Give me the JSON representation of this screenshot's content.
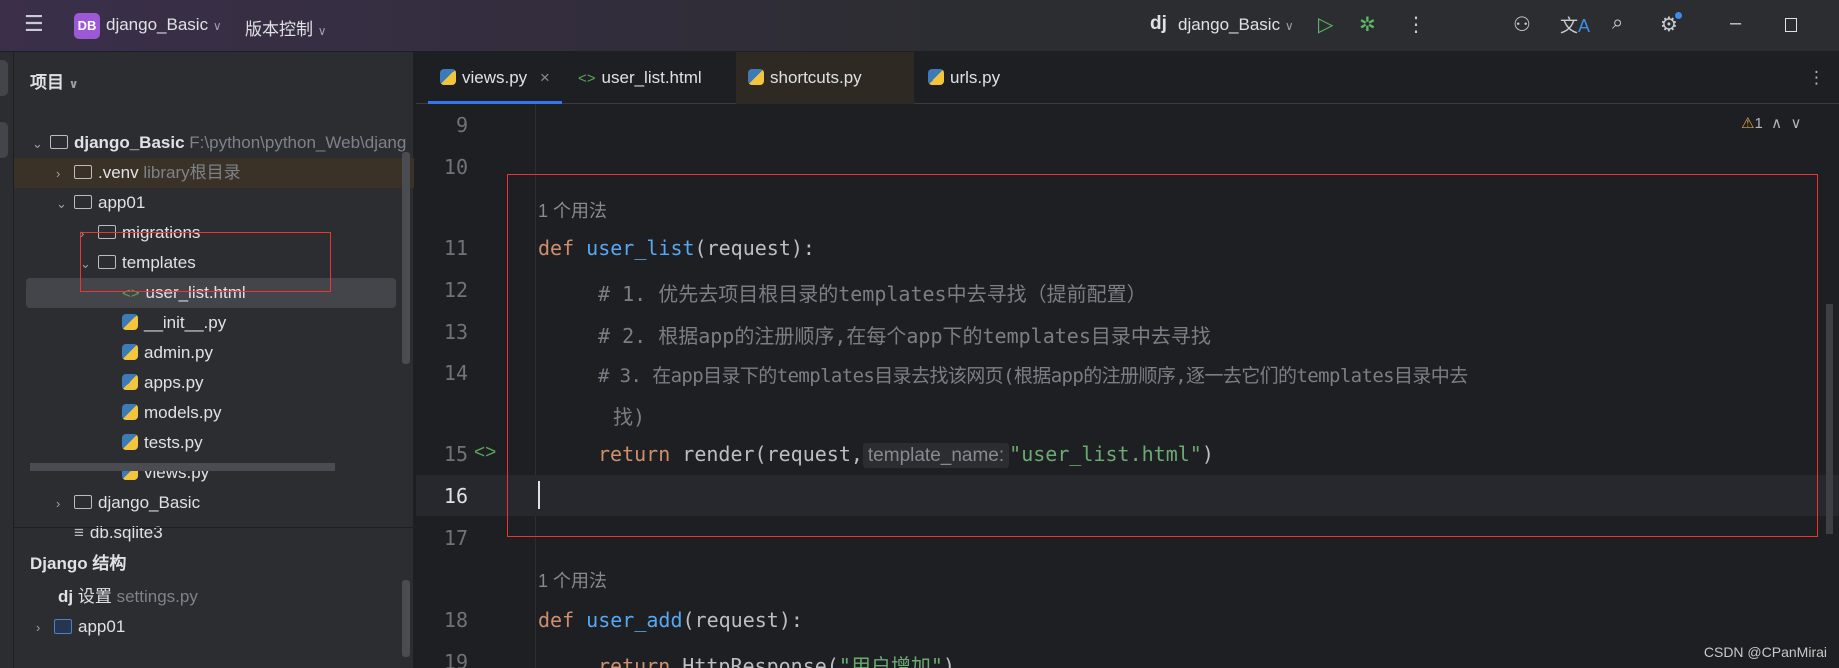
{
  "titlebar": {
    "menu_icon": "hamburger-icon",
    "project_badge": "DB",
    "project": "django_Basic",
    "vcs": "版本控制",
    "run_config": "django_Basic",
    "run_config_icon": "dj",
    "icons": [
      "run-icon",
      "debug-icon",
      "more-icon",
      "add-user-icon",
      "translate-icon",
      "search-icon",
      "settings-icon",
      "minimize-icon",
      "maximize-icon"
    ]
  },
  "panel": {
    "title": "项目",
    "tree": [
      {
        "label": "django_Basic",
        "hint": "F:\\python\\python_Web\\djang",
        "type": "folder",
        "expanded": true
      },
      {
        "label": ".venv",
        "hint": "library根目录",
        "type": "folder",
        "expanded": false
      },
      {
        "label": "app01",
        "type": "package",
        "expanded": true
      },
      {
        "label": "migrations",
        "type": "package",
        "expanded": false
      },
      {
        "label": "templates",
        "type": "folder",
        "expanded": true
      },
      {
        "label": "user_list.html",
        "type": "html"
      },
      {
        "label": "__init__.py",
        "type": "py"
      },
      {
        "label": "admin.py",
        "type": "py"
      },
      {
        "label": "apps.py",
        "type": "py"
      },
      {
        "label": "models.py",
        "type": "py"
      },
      {
        "label": "tests.py",
        "type": "py"
      },
      {
        "label": "views.py",
        "type": "py"
      },
      {
        "label": "django_Basic",
        "type": "package",
        "expanded": false
      },
      {
        "label": "db.sqlite3",
        "type": "file"
      }
    ],
    "structure_title": "Django 结构",
    "structure": [
      {
        "icon": "dj",
        "label": "设置",
        "hint": "settings.py"
      },
      {
        "label": "app01"
      }
    ]
  },
  "tabs": [
    {
      "label": "views.py",
      "active": true,
      "close": "×"
    },
    {
      "label": "user_list.html"
    },
    {
      "label": "shortcuts.py"
    },
    {
      "label": "urls.py"
    }
  ],
  "editor": {
    "warnings": "1",
    "usage_hint": "1 个用法",
    "lines": {
      "9": "9",
      "10": "10",
      "11": "11",
      "12": "12",
      "13": "13",
      "14": "14",
      "15": "15",
      "16": "16",
      "17": "17",
      "18": "18",
      "19": "19"
    },
    "l11": {
      "kw": "def",
      "fn": "user_list",
      "rest": "(request):"
    },
    "l12": "# 1. 优先去项目根目录的templates中去寻找（提前配置）",
    "l13": "# 2. 根据app的注册顺序,在每个app下的templates目录中去寻找",
    "l14": "# 3. 在app目录下的templates目录去找该网页(根据app的注册顺序,逐一去它们的templates目录中去",
    "l14b": "找)",
    "l15": {
      "kw": "return",
      "mid": " render(request,",
      "inlay": "template_name:",
      "str": "\"user_list.html\"",
      "end": ")"
    },
    "l18": {
      "kw": "def",
      "fn": "user_add",
      "rest": "(request):"
    },
    "l19": {
      "kw": "return",
      "mid": " HttpResponse(",
      "str": "\"用户增加\"",
      "end": ")"
    }
  },
  "watermark": "CSDN @CPanMirai",
  "colors": {
    "highlight": "#ee3333",
    "keyword": "#cf8e6d",
    "function": "#56a8f5",
    "string": "#6aab73",
    "comment": "#7a7e85"
  }
}
